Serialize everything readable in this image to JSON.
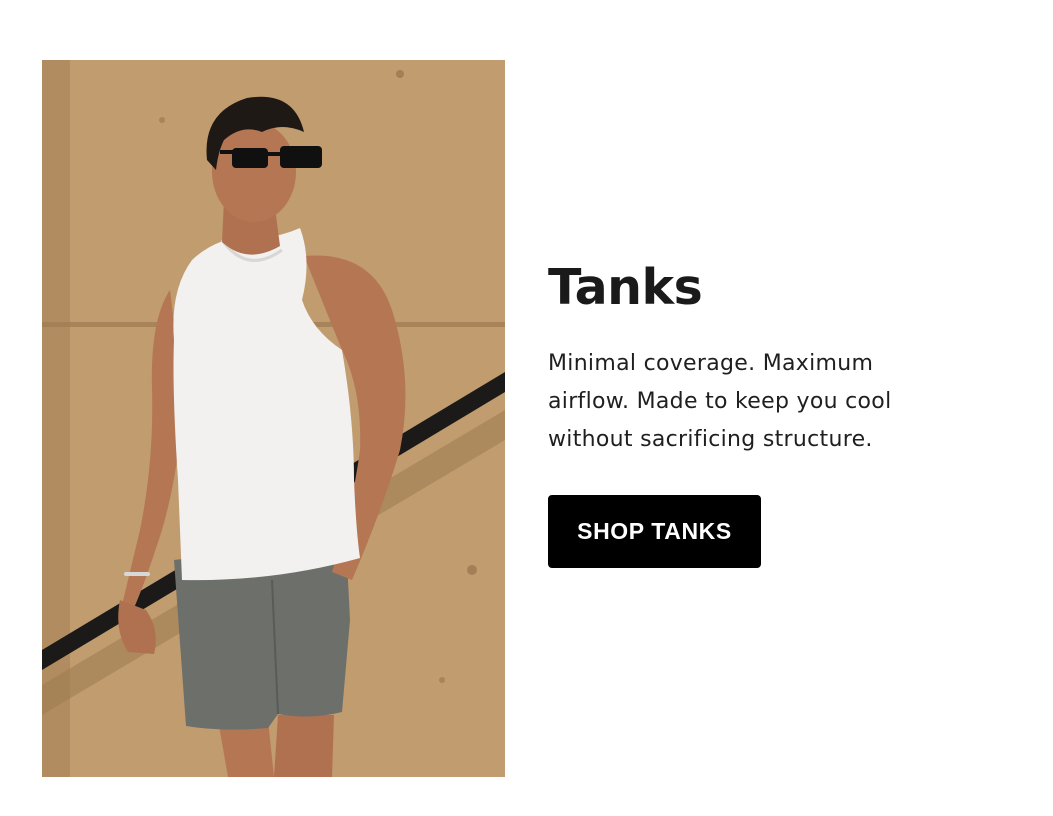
{
  "hero": {
    "image_alt": "Man wearing a white tank top, grey shorts and sunglasses against a concrete wall",
    "colors": {
      "wall": "#c19c6f",
      "wall_shadow": "#a9865c",
      "tank": "#f2f1ef",
      "shorts": "#6d6f6b",
      "skin": "#b97a57",
      "rail": "#1b1a18"
    }
  },
  "content": {
    "title": "Tanks",
    "description": "Minimal coverage. Maximum airflow. Made to keep you cool without sacrificing structure.",
    "cta_label": "SHOP TANKS"
  },
  "colors": {
    "background": "#ffffff",
    "text": "#1a1a1a",
    "button_bg": "#000000",
    "button_text": "#ffffff"
  }
}
